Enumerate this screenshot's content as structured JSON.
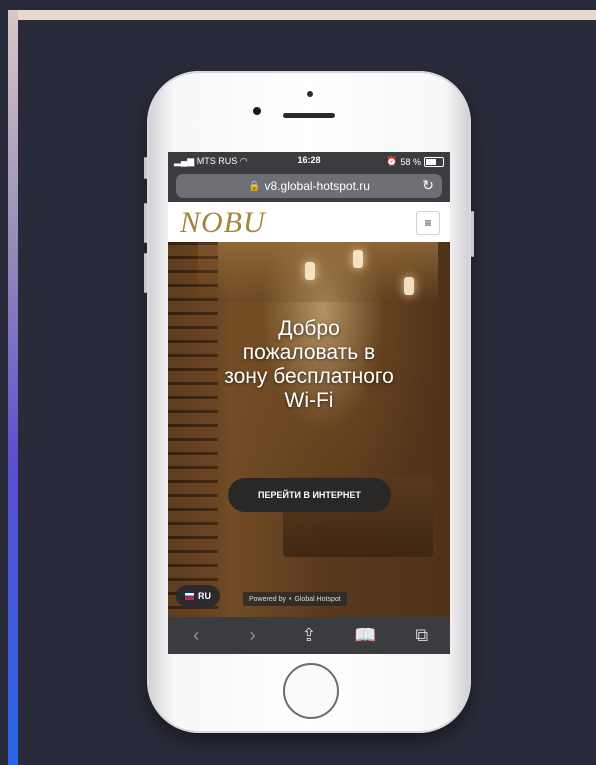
{
  "status_bar": {
    "carrier": "MTS RUS",
    "time": "16:28",
    "battery": "58 %"
  },
  "address_bar": {
    "url": "v8.global-hotspot.ru"
  },
  "site": {
    "logo": "NOBU",
    "welcome_line1": "Добро",
    "welcome_line2": "пожаловать в",
    "welcome_line3": "зону бесплатного",
    "welcome_line4": "Wi-Fi",
    "go_button": "ПЕРЕЙТИ В ИНТЕРНЕТ",
    "language": "RU",
    "powered_by": "Powered by",
    "powered_brand": "Global Hotspot"
  },
  "icons": {
    "signal": "signal-icon",
    "wifi": "wifi-icon",
    "lock": "lock-icon",
    "reload": "reload-icon",
    "menu": "hamburger-menu-icon",
    "back": "back-icon",
    "forward": "forward-icon",
    "share": "share-icon",
    "bookmarks": "bookmarks-icon",
    "tabs": "tabs-icon"
  },
  "colors": {
    "logo_gold": "#a3843a",
    "button_bg": "#2a2727",
    "browser_chrome": "#3b3c40"
  }
}
